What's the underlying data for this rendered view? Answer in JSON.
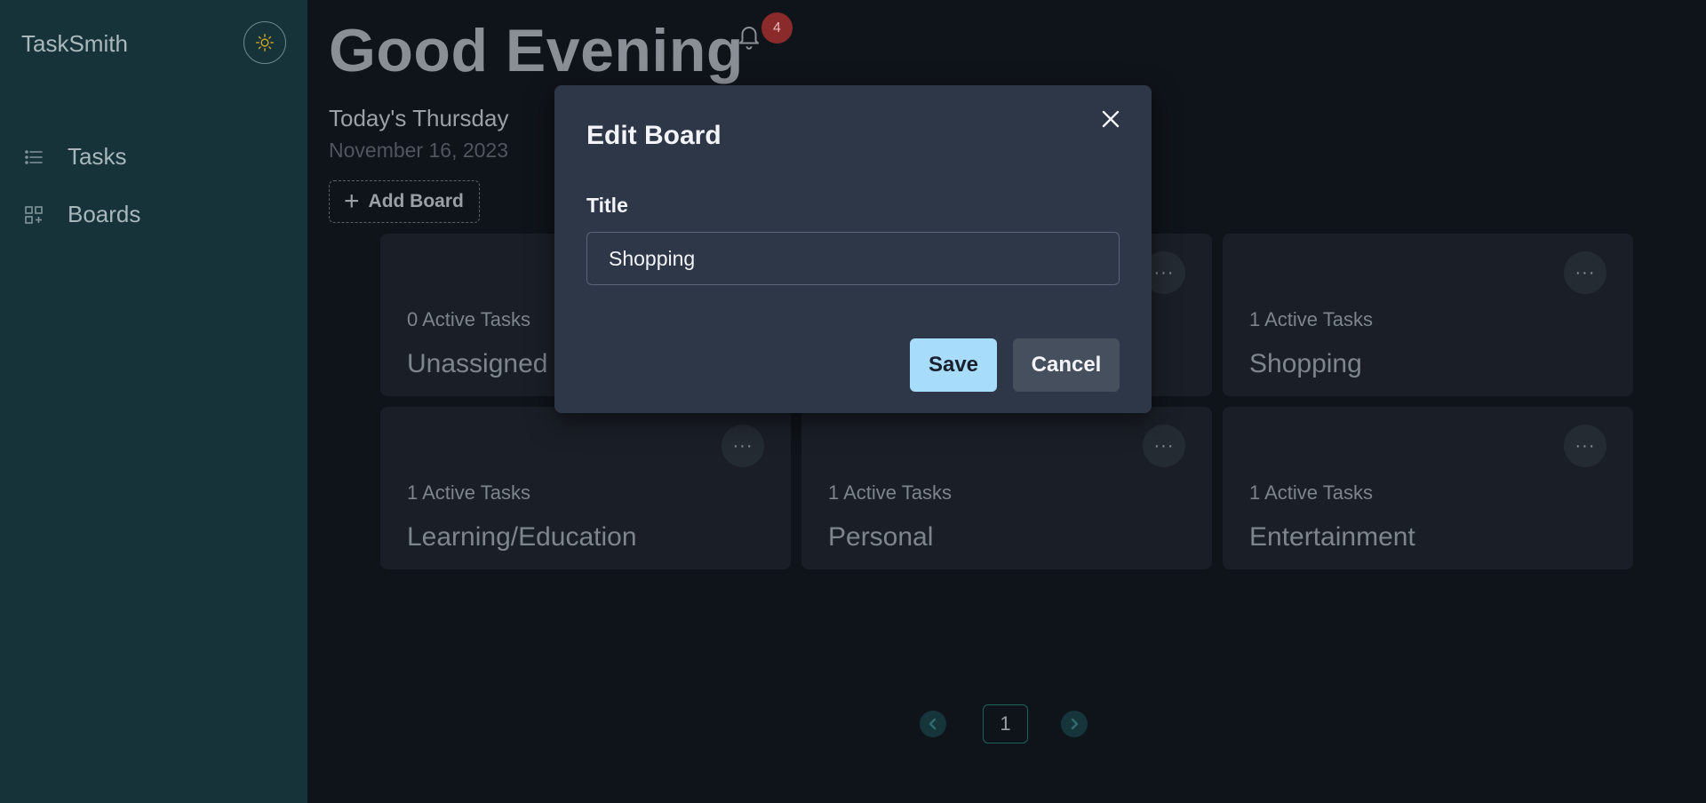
{
  "app": {
    "brand": "TaskSmith",
    "theme_toggle_icon": "sun-icon"
  },
  "sidebar": {
    "items": [
      {
        "label": "Tasks",
        "icon": "list-icon"
      },
      {
        "label": "Boards",
        "icon": "boards-icon"
      }
    ]
  },
  "header": {
    "greeting": "Good Evening",
    "day": "Today's Thursday",
    "date": "November 16, 2023",
    "notifications_count": "4",
    "add_board_label": "Add Board"
  },
  "boards": [
    {
      "count": "0 Active Tasks",
      "title": "Unassigned"
    },
    {
      "count": "",
      "title": ""
    },
    {
      "count": "1 Active Tasks",
      "title": "Shopping"
    },
    {
      "count": "1 Active Tasks",
      "title": "Learning/Education"
    },
    {
      "count": "1 Active Tasks",
      "title": "Personal"
    },
    {
      "count": "1 Active Tasks",
      "title": "Entertainment"
    }
  ],
  "pagination": {
    "current_page": "1"
  },
  "modal": {
    "title": "Edit Board",
    "field_label": "Title",
    "field_value": "Shopping",
    "save_label": "Save",
    "cancel_label": "Cancel"
  },
  "colors": {
    "sidebar_bg": "#17333a",
    "main_bg": "#0f141a",
    "modal_bg": "#2d3748",
    "save_button": "#a8dcfb",
    "badge": "#8b2a2a"
  }
}
